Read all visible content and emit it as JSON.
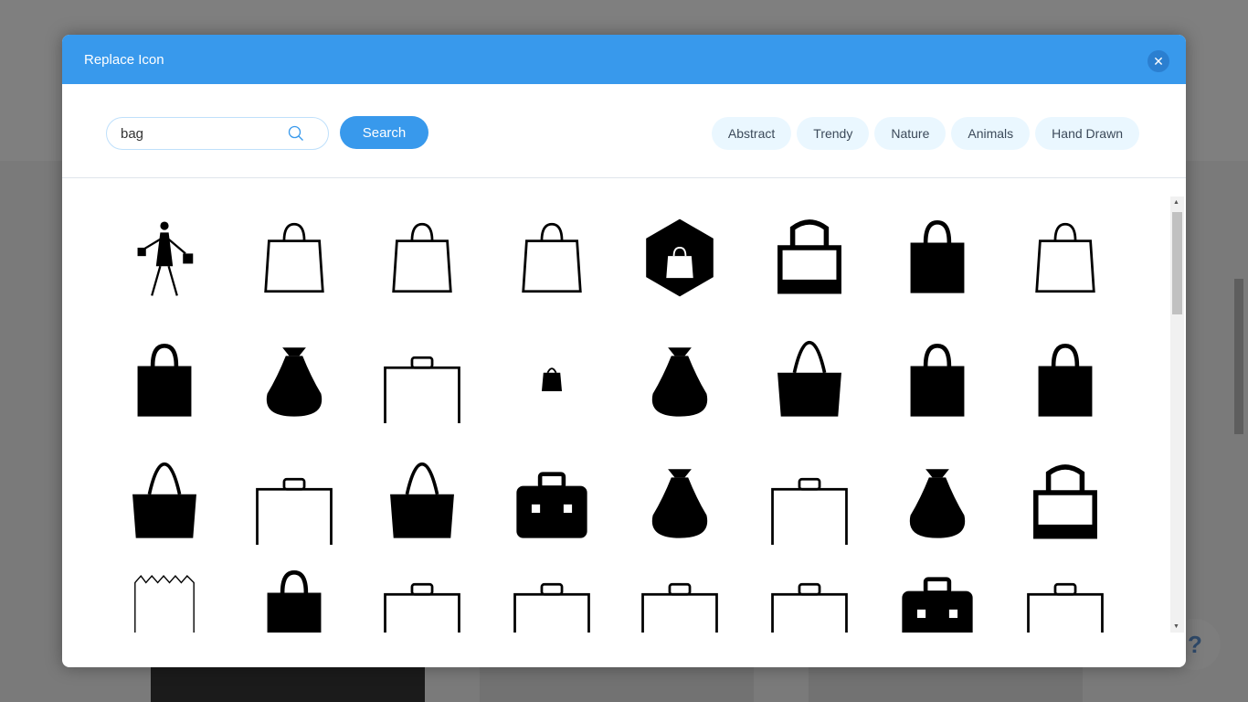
{
  "modal": {
    "title": "Replace Icon",
    "close_icon": "close-icon"
  },
  "search": {
    "value": "bag",
    "placeholder": "",
    "button_label": "Search"
  },
  "categories": [
    "Abstract",
    "Trendy",
    "Nature",
    "Animals",
    "Hand Drawn"
  ],
  "help": {
    "label": "?"
  },
  "colors": {
    "accent": "#3899ec",
    "chip_bg": "#eaf7ff"
  },
  "icons": [
    "woman-shopping-icon",
    "paper-bag-outline-icon",
    "sketch-bag-icon",
    "sketch-shopping-bag-icon",
    "hexagon-bag-icon",
    "tote-bag-outline-icon",
    "solid-tote-icon",
    "coffee-bag-icon",
    "solid-tote-tall-icon",
    "sack-icon",
    "lunch-bag-outline-icon",
    "small-handbag-icon",
    "hand-holding-bag-icon",
    "canvas-bag-icon",
    "gift-bag-icon",
    "small-sack-icon",
    "handbag-icon",
    "purse-icon",
    "leather-handbag-icon",
    "toolbox-icon",
    "money-sack-icon",
    "satchel-icon",
    "plastic-bag-icon",
    "tote-frame-icon",
    "paper-bag-zigzag-icon",
    "solid-briefcase-icon",
    "briefcase-download-icon",
    "briefcase-delete-icon",
    "briefcase-upload-icon",
    "briefcase-outline-icon",
    "briefcase-solid-icon",
    "briefcase-heart-icon"
  ]
}
